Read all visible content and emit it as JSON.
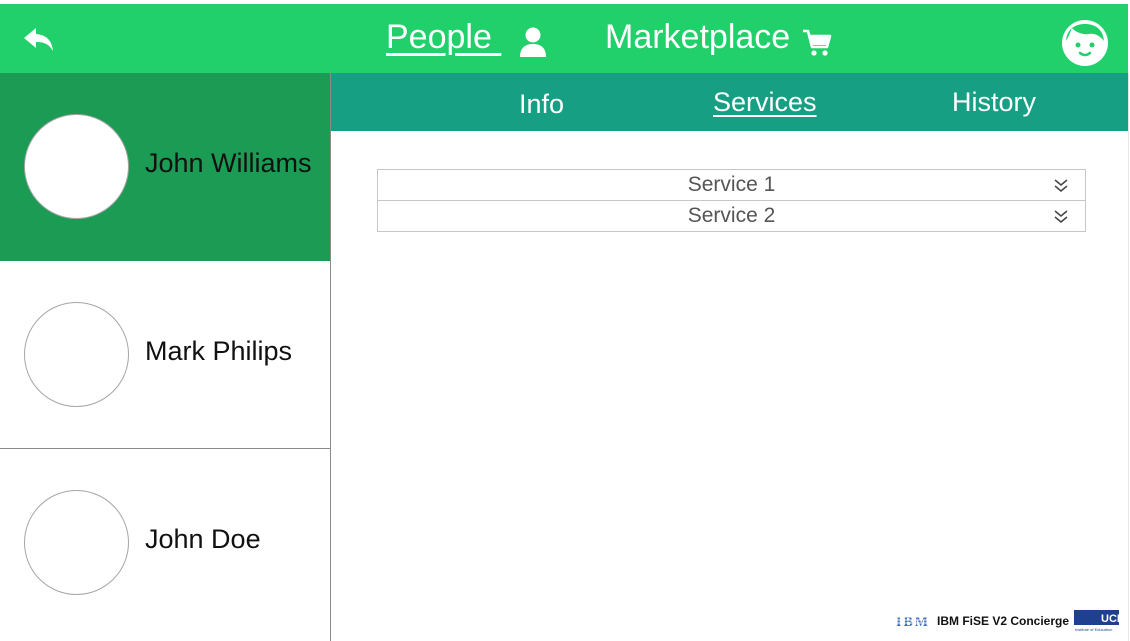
{
  "header": {
    "nav_people": "People ",
    "nav_marketplace": "Marketplace",
    "icons": [
      "back-arrow-icon",
      "person-icon",
      "cart-icon",
      "face-avatar-icon"
    ],
    "colors": {
      "bar": "#21d06b",
      "text": "#ffffff"
    }
  },
  "sidebar": {
    "people": [
      {
        "name": "John Williams",
        "active": true
      },
      {
        "name": "Mark Philips",
        "active": false
      },
      {
        "name": "John Doe",
        "active": false
      }
    ],
    "colors": {
      "active": "#1c9b54"
    }
  },
  "tabs": {
    "items": [
      {
        "label": "Info",
        "active": false
      },
      {
        "label": "Services",
        "active": true
      },
      {
        "label": "History",
        "active": false
      }
    ],
    "color": "#179f84"
  },
  "services": {
    "items": [
      {
        "title": "Service 1",
        "icon": "double-chevron-down-icon"
      },
      {
        "title": "Service 2",
        "icon": "double-chevron-down-icon"
      }
    ]
  },
  "footer": {
    "brand_text": "IBM FiSE V2 Concierge",
    "ibm_logo": "IBM",
    "ucl_logo": "UCL",
    "ucl_subtext": "Institute of Education"
  }
}
